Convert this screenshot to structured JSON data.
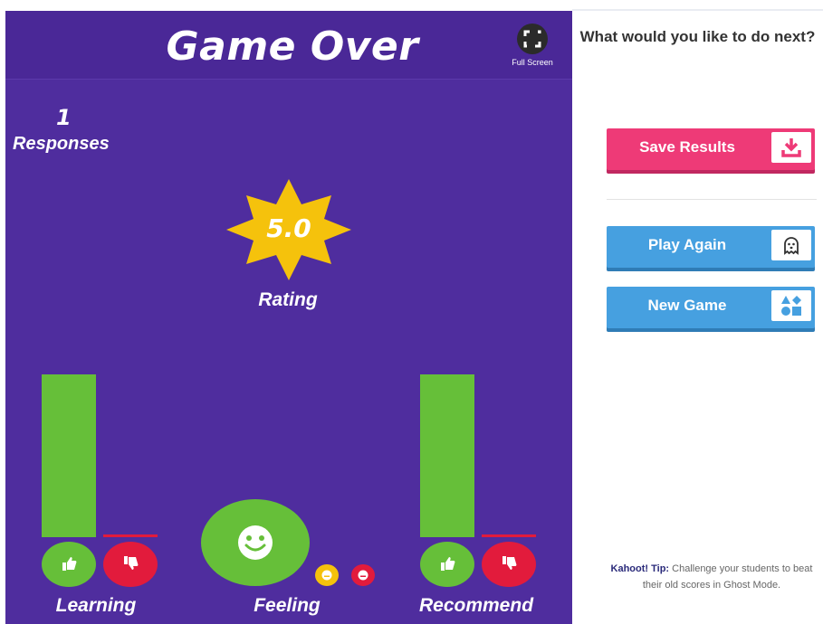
{
  "game": {
    "title": "Game Over",
    "fullscreen_label": "Full Screen",
    "responses": {
      "count": "1",
      "label": "Responses"
    },
    "rating": {
      "value": "5.0",
      "label": "Rating"
    },
    "categories": {
      "learning": {
        "label": "Learning",
        "up_fraction": 1.0,
        "down_fraction": 0.0
      },
      "feeling": {
        "label": "Feeling"
      },
      "recommend": {
        "label": "Recommend",
        "up_fraction": 1.0,
        "down_fraction": 0.0
      }
    }
  },
  "sidebar": {
    "title": "What would you like to do next?",
    "buttons": {
      "save": "Save Results",
      "play_again": "Play Again",
      "new_game": "New Game"
    },
    "tip": {
      "label": "Kahoot! Tip:",
      "text": " Challenge your students to beat their old scores in Ghost Mode."
    }
  },
  "colors": {
    "panel": "#4f2d9e",
    "green": "#66bf39",
    "red": "#e21b3c",
    "yellow": "#f5c20c",
    "pink": "#ee3a77",
    "blue": "#46a0e0"
  }
}
